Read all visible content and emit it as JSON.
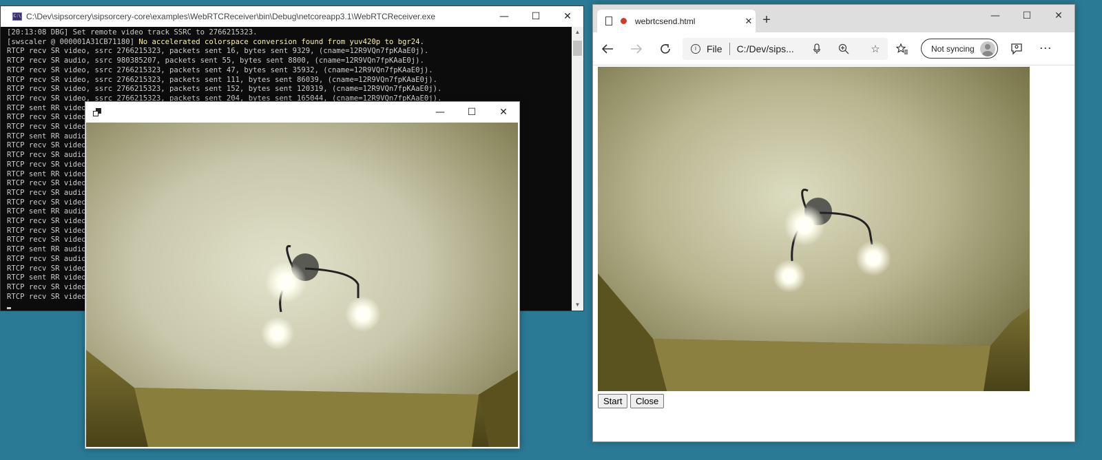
{
  "console": {
    "title": "C:\\Dev\\sipsorcery\\sipsorcery-core\\examples\\WebRTCReceiver\\bin\\Debug\\netcoreapp3.1\\WebRTCReceiver.exe",
    "icon_label": "C:\\",
    "lines": [
      {
        "text": "[20:13:08 DBG] Set remote video track SSRC to 2766215323.",
        "hl": ""
      },
      {
        "text": "[swscaler @ 000001A31CB71180] ",
        "hl": "No accelerated colorspace conversion found from yuv420p to bgr24."
      },
      {
        "text": "RTCP recv SR video, ssrc 2766215323, packets sent 16, bytes sent 9329, (cname=12R9VQn7fpKAaE0j).",
        "hl": ""
      },
      {
        "text": "RTCP recv SR audio, ssrc 980385207, packets sent 55, bytes sent 8800, (cname=12R9VQn7fpKAaE0j).",
        "hl": ""
      },
      {
        "text": "RTCP recv SR video, ssrc 2766215323, packets sent 47, bytes sent 35932, (cname=12R9VQn7fpKAaE0j).",
        "hl": ""
      },
      {
        "text": "RTCP recv SR video, ssrc 2766215323, packets sent 111, bytes sent 86039, (cname=12R9VQn7fpKAaE0j).",
        "hl": ""
      },
      {
        "text": "RTCP recv SR video, ssrc 2766215323, packets sent 152, bytes sent 120319, (cname=12R9VQn7fpKAaE0j).",
        "hl": ""
      },
      {
        "text": "RTCP recv SR video, ssrc 2766215323, packets sent 204, bytes sent 165044, (cname=12R9VQn7fpKAaE0j).",
        "hl": ""
      },
      {
        "text": "RTCP sent RR video",
        "hl": ""
      },
      {
        "text": "RTCP recv SR video",
        "hl": ""
      },
      {
        "text": "RTCP recv SR video",
        "hl": ""
      },
      {
        "text": "RTCP sent RR audio",
        "hl": ""
      },
      {
        "text": "RTCP recv SR video",
        "hl": ""
      },
      {
        "text": "RTCP recv SR audio",
        "hl": ""
      },
      {
        "text": "RTCP recv SR video",
        "hl": ""
      },
      {
        "text": "RTCP sent RR video",
        "hl": ""
      },
      {
        "text": "RTCP recv SR video",
        "hl": ""
      },
      {
        "text": "RTCP recv SR audio",
        "hl": ""
      },
      {
        "text": "RTCP recv SR video",
        "hl": ""
      },
      {
        "text": "RTCP sent RR audio",
        "hl": ""
      },
      {
        "text": "RTCP recv SR video",
        "hl": ""
      },
      {
        "text": "RTCP recv SR video",
        "hl": ""
      },
      {
        "text": "RTCP recv SR video",
        "hl": ""
      },
      {
        "text": "RTCP sent RR audio",
        "hl": ""
      },
      {
        "text": "RTCP recv SR audio",
        "hl": ""
      },
      {
        "text": "RTCP recv SR video",
        "hl": ""
      },
      {
        "text": "RTCP sent RR video",
        "hl": ""
      },
      {
        "text": "RTCP recv SR video",
        "hl": ""
      },
      {
        "text": "RTCP recv SR video",
        "hl": ""
      }
    ]
  },
  "browser": {
    "tab_title": "webrtcsend.html",
    "address_scheme": "File",
    "address_url": "C:/Dev/sips...",
    "sync_label": "Not syncing",
    "buttons": {
      "start": "Start",
      "close": "Close"
    }
  },
  "window_controls": {
    "minimize": "—",
    "maximize": "☐",
    "close": "✕"
  },
  "colors": {
    "desktop": "#2a7a96",
    "console_bg": "#0c0c0c",
    "console_text": "#cccccc",
    "console_highlight": "#f9f1a5",
    "recording_dot": "#d13a2a"
  }
}
